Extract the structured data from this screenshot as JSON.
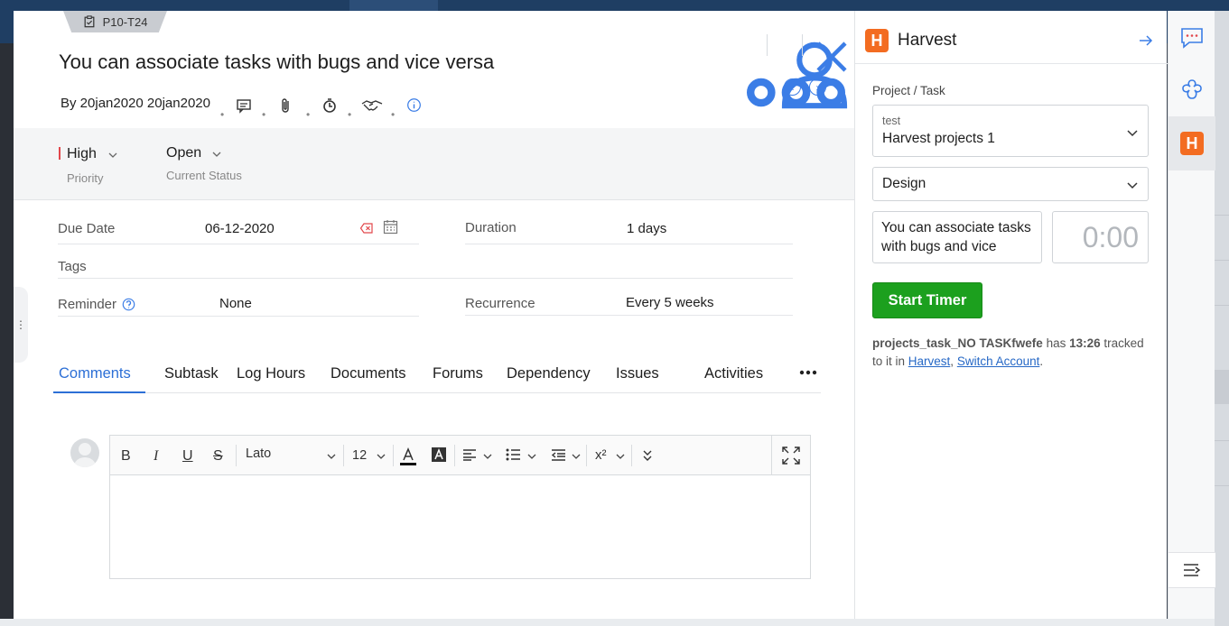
{
  "task": {
    "id": "P10-T24",
    "title": "You can associate tasks with bugs and vice versa",
    "byline": "By 20jan2020 20jan2020"
  },
  "status": {
    "priority_value": "High",
    "priority_label": "Priority",
    "status_value": "Open",
    "status_label": "Current Status"
  },
  "fields": {
    "due_date_label": "Due Date",
    "due_date_value": "06-12-2020",
    "duration_label": "Duration",
    "duration_value": "1 days",
    "tags_label": "Tags",
    "reminder_label": "Reminder",
    "reminder_value": "None",
    "recurrence_label": "Recurrence",
    "recurrence_value": "Every 5 weeks"
  },
  "tabs": [
    "Comments",
    "Subtask",
    "Log Hours",
    "Documents",
    "Forums",
    "Dependency",
    "Issues",
    "Activities"
  ],
  "editor": {
    "font": "Lato",
    "size": "12",
    "bold": "B",
    "italic": "I",
    "underline": "U",
    "strike": "S",
    "superscript": "x²"
  },
  "harvest": {
    "title": "Harvest",
    "logo_letter": "H",
    "project_task_label": "Project / Task",
    "project_small": "test",
    "project_value": "Harvest projects 1",
    "task_value": "Design",
    "notes": "You can associate tasks with bugs and vice",
    "timer": "0:00",
    "start_button": "Start Timer",
    "info_user": "projects_task_NO TASKfwefe",
    "info_has": " has ",
    "info_time": "13:26",
    "info_tracked": " tracked to it in ",
    "info_link1": "Harvest",
    "info_comma": ", ",
    "info_link2": "Switch Account",
    "info_period": "."
  },
  "colors": {
    "accent_blue": "#2c6fd6",
    "priority_red": "#e2474b",
    "harvest_orange": "#f36c21",
    "start_green": "#1ca01e"
  }
}
